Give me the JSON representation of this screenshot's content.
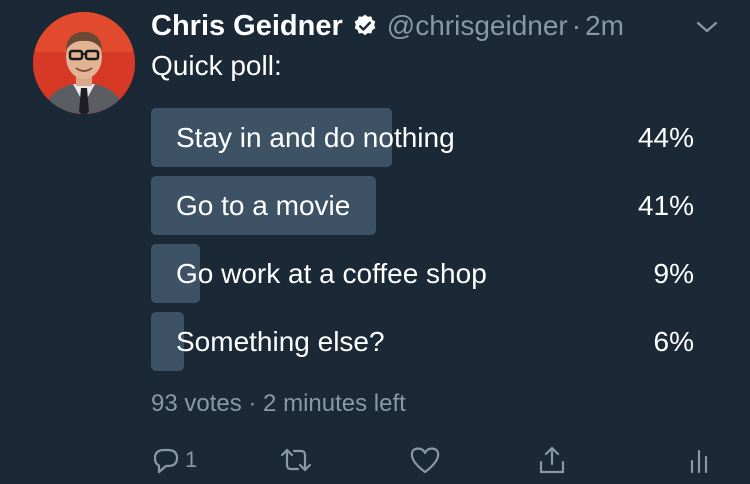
{
  "tweet": {
    "author_name": "Chris Geidner",
    "handle": "@chrisgeidner",
    "separator": "·",
    "time": "2m",
    "text": "Quick poll:"
  },
  "poll": {
    "options": [
      {
        "label": "Stay in and do nothing",
        "percent_label": "44%",
        "fraction": 0.44
      },
      {
        "label": "Go to a movie",
        "percent_label": "41%",
        "fraction": 0.41
      },
      {
        "label": "Go work at a coffee shop",
        "percent_label": "9%",
        "fraction": 0.09
      },
      {
        "label": "Something else?",
        "percent_label": "6%",
        "fraction": 0.06
      }
    ],
    "meta": "93 votes · 2 minutes left"
  },
  "actions": {
    "reply_count": "1",
    "icons": [
      "reply-icon",
      "retweet-icon",
      "like-icon",
      "share-icon",
      "analytics-icon"
    ]
  },
  "colors": {
    "background": "#1b2836",
    "poll_bar": "#3e5266",
    "muted": "#8899a6",
    "text": "#ffffff",
    "verified": "#ffffff"
  }
}
